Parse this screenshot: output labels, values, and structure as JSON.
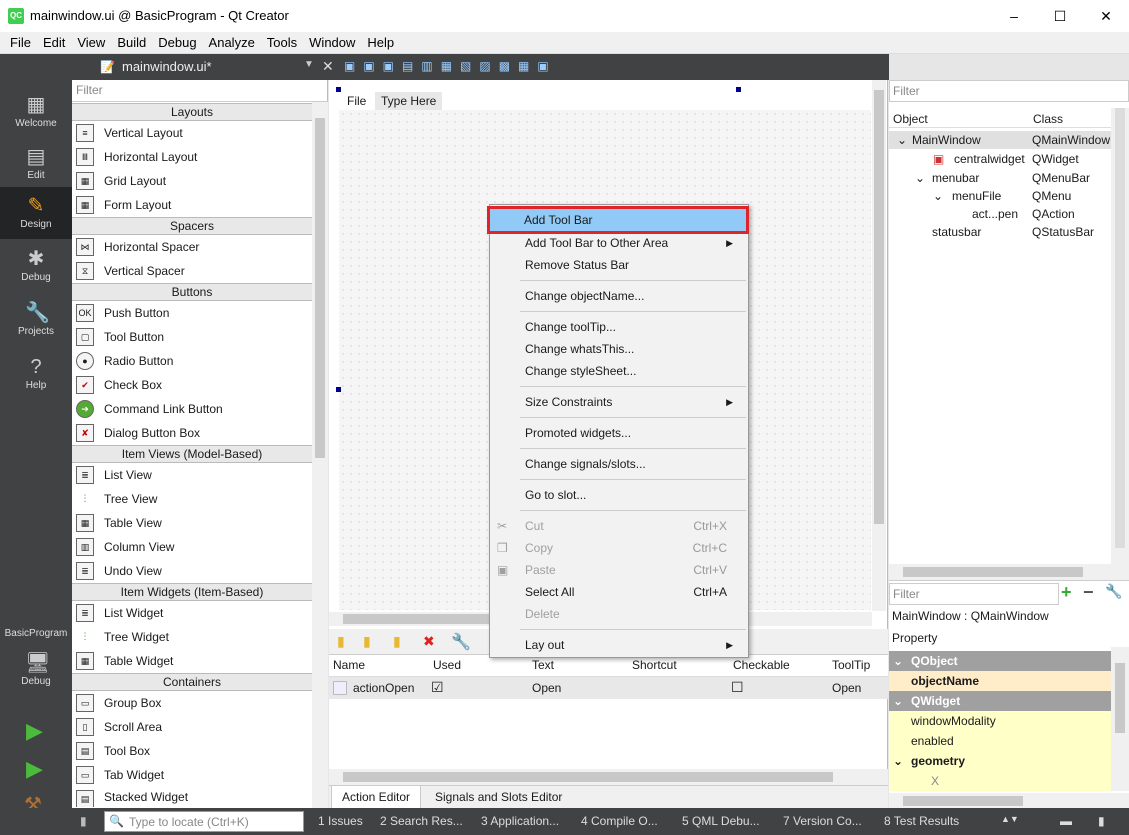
{
  "window": {
    "title": "mainwindow.ui @ BasicProgram - Qt Creator",
    "logo": "QC",
    "minimize": "–",
    "maximize": "☐",
    "close": "✕"
  },
  "menubar": [
    "File",
    "Edit",
    "View",
    "Build",
    "Debug",
    "Analyze",
    "Tools",
    "Window",
    "Help"
  ],
  "modes": [
    {
      "label": "Welcome",
      "icon": "grid-icon"
    },
    {
      "label": "Edit",
      "icon": "document-icon"
    },
    {
      "label": "Design",
      "icon": "pencil-icon"
    },
    {
      "label": "Debug",
      "icon": "bug-icon"
    },
    {
      "label": "Projects",
      "icon": "wrench-icon"
    },
    {
      "label": "Help",
      "icon": "question-icon"
    }
  ],
  "kit": {
    "project": "BasicProgram",
    "label": "Debug"
  },
  "doc_tab": {
    "filename": "mainwindow.ui*"
  },
  "widget_box": {
    "filter_placeholder": "Filter",
    "categories": {
      "layouts": "Layouts",
      "spacers": "Spacers",
      "buttons": "Buttons",
      "item_views": "Item Views (Model-Based)",
      "item_widgets": "Item Widgets (Item-Based)",
      "containers": "Containers"
    },
    "items": [
      "Vertical Layout",
      "Horizontal Layout",
      "Grid Layout",
      "Form Layout",
      "Horizontal Spacer",
      "Vertical Spacer",
      "Push Button",
      "Tool Button",
      "Radio Button",
      "Check Box",
      "Command Link Button",
      "Dialog Button Box",
      "List View",
      "Tree View",
      "Table View",
      "Column View",
      "Undo View",
      "List Widget",
      "Tree Widget",
      "Table Widget",
      "Group Box",
      "Scroll Area",
      "Tool Box",
      "Tab Widget",
      "Stacked Widget"
    ]
  },
  "form_menu": {
    "file": "File",
    "type_here": "Type Here"
  },
  "context_menu": {
    "add_toolbar": "Add Tool Bar",
    "add_toolbar_other": "Add Tool Bar to Other Area",
    "remove_statusbar": "Remove Status Bar",
    "change_objectname": "Change objectName...",
    "change_tooltip": "Change toolTip...",
    "change_whatsthis": "Change whatsThis...",
    "change_stylesheet": "Change styleSheet...",
    "size_constraints": "Size Constraints",
    "promoted": "Promoted widgets...",
    "signals_slots": "Change signals/slots...",
    "go_to_slot": "Go to slot...",
    "cut": "Cut",
    "cut_sc": "Ctrl+X",
    "copy": "Copy",
    "copy_sc": "Ctrl+C",
    "paste": "Paste",
    "paste_sc": "Ctrl+V",
    "select_all": "Select All",
    "select_all_sc": "Ctrl+A",
    "delete": "Delete",
    "lay_out": "Lay out"
  },
  "action_editor": {
    "headers": [
      "Name",
      "Used",
      "Text",
      "Shortcut",
      "Checkable",
      "ToolTip"
    ],
    "row": {
      "name": "actionOpen",
      "used": "☑",
      "text": "Open",
      "checkable": "☐",
      "tooltip": "Open"
    },
    "tabs": [
      "Action Editor",
      "Signals and Slots Editor"
    ]
  },
  "object_inspector": {
    "filter_placeholder": "Filter",
    "headers": [
      "Object",
      "Class"
    ],
    "rows": [
      {
        "object": "MainWindow",
        "class": "QMainWindow"
      },
      {
        "object": "centralwidget",
        "class": "QWidget"
      },
      {
        "object": "menubar",
        "class": "QMenuBar"
      },
      {
        "object": "menuFile",
        "class": "QMenu"
      },
      {
        "object": "act...pen",
        "class": "QAction"
      },
      {
        "object": "statusbar",
        "class": "QStatusBar"
      }
    ]
  },
  "property_editor": {
    "filter_placeholder": "Filter",
    "context": "MainWindow : QMainWindow",
    "header": "Property",
    "rows": [
      "QObject",
      "objectName",
      "QWidget",
      "windowModality",
      "enabled",
      "geometry",
      "X"
    ]
  },
  "statusbar": {
    "locate_placeholder": "Type to locate (Ctrl+K)",
    "panes": [
      "1  Issues",
      "2  Search Res...",
      "3  Application...",
      "4  Compile O...",
      "5  QML Debu...",
      "7  Version Co...",
      "8  Test Results"
    ]
  }
}
